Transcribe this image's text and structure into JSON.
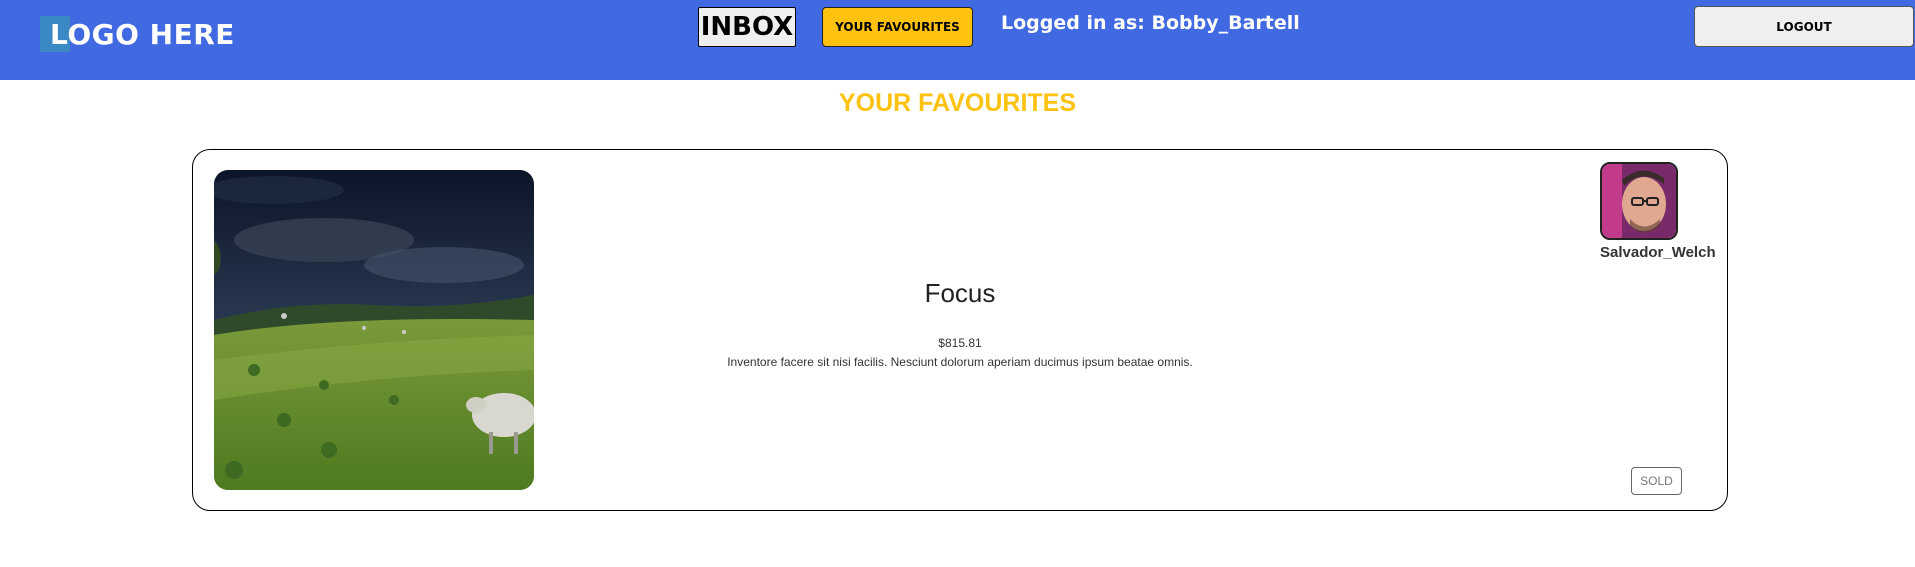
{
  "header": {
    "logo_text": "LOGO HERE",
    "inbox_label": "INBOX",
    "favourites_label": "YOUR FAVOURITES",
    "logged_in_text": "Logged in as: Bobby_Bartell",
    "logout_label": "LOGOUT"
  },
  "page": {
    "heading": "YOUR FAVOURITES"
  },
  "favourites": [
    {
      "title": "Focus",
      "price": "$815.81",
      "description": "Inventore facere sit nisi facilis. Nesciunt dolorum aperiam ducimus ipsum beatae omnis.",
      "seller": "Salvador_Welch",
      "status": "SOLD"
    }
  ],
  "colors": {
    "nav_background": "#4169e1",
    "accent": "#ffc20e"
  }
}
